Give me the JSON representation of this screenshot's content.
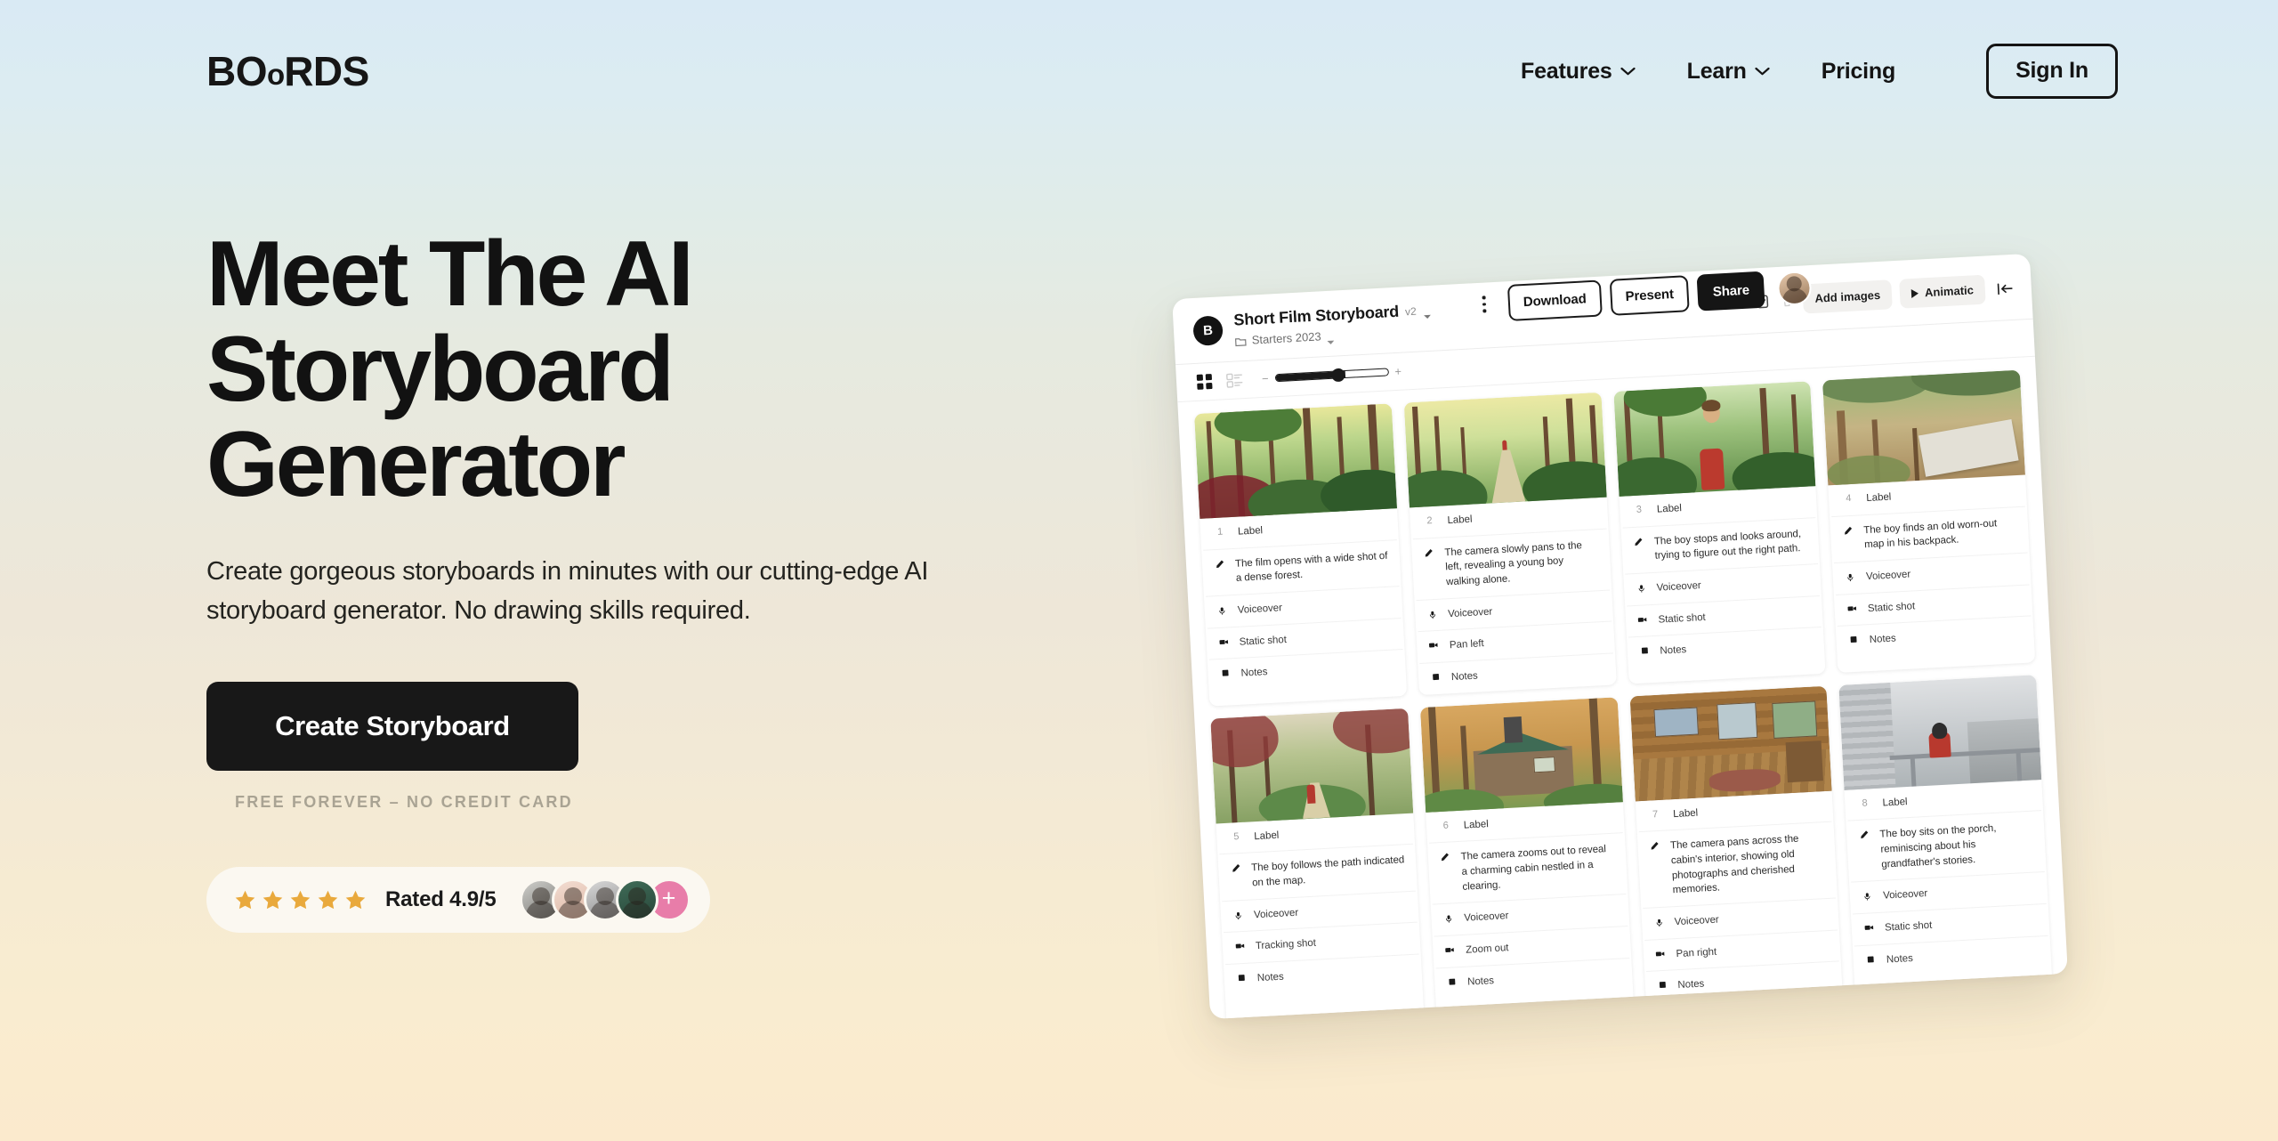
{
  "brand": {
    "logo_text": "BOORDS",
    "logo_parts": [
      "B",
      "O",
      "o",
      "R",
      "D",
      "S"
    ]
  },
  "nav": {
    "items": [
      {
        "label": "Features",
        "has_dropdown": true,
        "icon": "chevron-down-icon"
      },
      {
        "label": "Learn",
        "has_dropdown": true,
        "icon": "chevron-down-icon"
      },
      {
        "label": "Pricing",
        "has_dropdown": false,
        "icon": ""
      }
    ],
    "signin_label": "Sign In"
  },
  "hero": {
    "title": "Meet The AI Storyboard Generator",
    "subtitle": "Create gorgeous storyboards in minutes with our cutting-edge AI storyboard generator. No drawing skills required.",
    "cta_label": "Create Storyboard",
    "cta_note": "FREE FOREVER – NO CREDIT CARD",
    "rating": {
      "stars": 5,
      "star_icon": "star-icon",
      "text": "Rated 4.9/5",
      "avatar_count": 4,
      "add_label": "+"
    }
  },
  "colors": {
    "ink": "#141414",
    "cta_bg": "#181818",
    "star_gold": "#e9a93c",
    "avatar_plus": "#e87da9",
    "pill_bg": "#fbf8f1",
    "gradient_top": "#d9eaf4",
    "gradient_mid": "#eae8dc",
    "gradient_bottom": "#fbeacd"
  },
  "app": {
    "badge_letter": "B",
    "project_title": "Short Film Storyboard",
    "version": "v2",
    "folder": "Starters 2023",
    "folder_icon": "folder-icon",
    "caret_icon": "caret-down-icon",
    "menu_icon": "kebab-menu-icon",
    "top_actions": [
      {
        "label": "Download",
        "style": "outline"
      },
      {
        "label": "Present",
        "style": "outline"
      },
      {
        "label": "Share",
        "style": "dark"
      }
    ],
    "avatar_icon": "user-avatar",
    "header_actions": {
      "undo_icon": "undo-icon",
      "redo_icon": "redo-icon",
      "copy_icon": "copy-icon",
      "trash_icon": "trash-icon",
      "add_images_label": "Add images",
      "animatic_label": "Animatic",
      "play_icon": "play-icon",
      "collapse_icon": "collapse-panel-icon"
    },
    "toolbar": {
      "grid_view_icon": "grid-view-icon",
      "list_view_icon": "list-view-icon",
      "zoom_out_label": "−",
      "zoom_in_label": "+",
      "zoom_value": 56
    },
    "row_labels": {
      "label": "Label",
      "voiceover": "Voiceover",
      "notes": "Notes"
    },
    "icons": {
      "script": "script-pencil-icon",
      "voiceover": "microphone-icon",
      "camera": "camera-move-icon",
      "notes": "notes-icon"
    },
    "frames": [
      {
        "number": "1",
        "label": "Label",
        "description": "The film opens with a wide shot of a dense forest.",
        "voiceover": "Voiceover",
        "shot": "Static shot",
        "notes": "Notes",
        "scene": "dense forest"
      },
      {
        "number": "2",
        "label": "Label",
        "description": "The camera slowly pans to the left, revealing a young boy walking alone.",
        "voiceover": "Voiceover",
        "shot": "Pan left",
        "notes": "Notes",
        "scene": "forest path with distant figure"
      },
      {
        "number": "3",
        "label": "Label",
        "description": "The boy stops and looks around, trying to figure out the right path.",
        "voiceover": "Voiceover",
        "shot": "Static shot",
        "notes": "Notes",
        "scene": "boy in red shirt in forest"
      },
      {
        "number": "4",
        "label": "Label",
        "description": "The boy finds an old worn-out map in his backpack.",
        "voiceover": "Voiceover",
        "shot": "Static shot",
        "notes": "Notes",
        "scene": "old map on forest floor"
      },
      {
        "number": "5",
        "label": "Label",
        "description": "The boy follows the path indicated on the map.",
        "voiceover": "Voiceover",
        "shot": "Tracking shot",
        "notes": "Notes",
        "scene": "boy walking forest path"
      },
      {
        "number": "6",
        "label": "Label",
        "description": "The camera zooms out to reveal a charming cabin nestled in a clearing.",
        "voiceover": "Voiceover",
        "shot": "Zoom out",
        "notes": "Notes",
        "scene": "cabin with green roof"
      },
      {
        "number": "7",
        "label": "Label",
        "description": "The camera pans across the cabin's interior, showing old photographs and cherished memories.",
        "voiceover": "Voiceover",
        "shot": "Pan right",
        "notes": "Notes",
        "scene": "log cabin interior"
      },
      {
        "number": "8",
        "label": "Label",
        "description": "The boy sits on the porch, reminiscing about his grandfather's stories.",
        "voiceover": "Voiceover",
        "shot": "Static shot",
        "notes": "Notes",
        "scene": "boy on porch, greyscale"
      }
    ]
  }
}
